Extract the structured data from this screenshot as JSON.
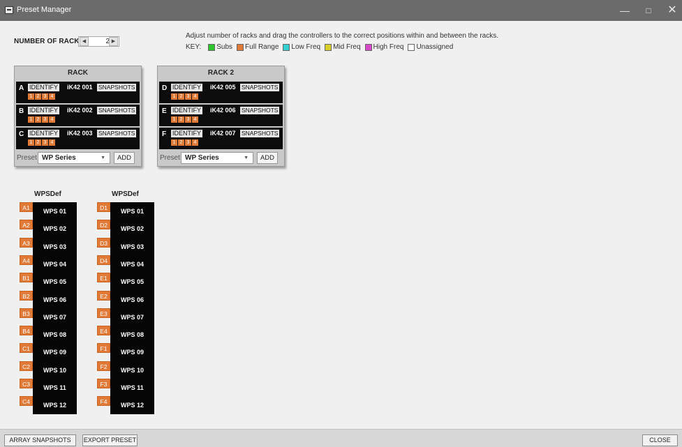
{
  "window": {
    "title": "Preset Manager",
    "minimize_icon": "minimize-icon",
    "maximize_icon": "maximize-icon",
    "close_icon": "close-icon"
  },
  "controls": {
    "num_racks_label": "NUMBER OF RACKS",
    "num_racks_value": "2",
    "instructions": "Adjust number of racks and drag the controllers to the correct positions within and between the racks.",
    "key_label": "KEY:"
  },
  "key": [
    {
      "label": "Subs",
      "color": "#2ec52e"
    },
    {
      "label": "Full Range",
      "color": "#e27a37"
    },
    {
      "label": "Low Freq",
      "color": "#35d0d0"
    },
    {
      "label": "Mid Freq",
      "color": "#d7d02a"
    },
    {
      "label": "High Freq",
      "color": "#d548c8"
    },
    {
      "label": "Unassigned",
      "color": "#ffffff"
    }
  ],
  "racks": [
    {
      "title": "RACK",
      "slots": [
        {
          "letter": "A",
          "identify": "IDENTIFY",
          "name": "iK42 001",
          "snapshots": "SNAPSHOTS",
          "channels": [
            "1",
            "2",
            "3",
            "4"
          ]
        },
        {
          "letter": "B",
          "identify": "IDENTIFY",
          "name": "iK42 002",
          "snapshots": "SNAPSHOTS",
          "channels": [
            "1",
            "2",
            "3",
            "4"
          ]
        },
        {
          "letter": "C",
          "identify": "IDENTIFY",
          "name": "iK42 003",
          "snapshots": "SNAPSHOTS",
          "channels": [
            "1",
            "2",
            "3",
            "4"
          ]
        }
      ],
      "preset_label": "Preset",
      "preset_value": "WP Series",
      "add_label": "ADD"
    },
    {
      "title": "RACK 2",
      "slots": [
        {
          "letter": "D",
          "identify": "IDENTIFY",
          "name": "iK42 005",
          "snapshots": "SNAPSHOTS",
          "channels": [
            "1",
            "2",
            "3",
            "4"
          ]
        },
        {
          "letter": "E",
          "identify": "IDENTIFY",
          "name": "iK42 006",
          "snapshots": "SNAPSHOTS",
          "channels": [
            "1",
            "2",
            "3",
            "4"
          ]
        },
        {
          "letter": "F",
          "identify": "IDENTIFY",
          "name": "iK42 007",
          "snapshots": "SNAPSHOTS",
          "channels": [
            "1",
            "2",
            "3",
            "4"
          ]
        }
      ],
      "preset_label": "Preset",
      "preset_value": "WP Series",
      "add_label": "ADD"
    }
  ],
  "preset_columns": [
    {
      "title": "WPSDef",
      "rows": [
        {
          "tag": "A1",
          "name": "WPS 01"
        },
        {
          "tag": "A2",
          "name": "WPS 02"
        },
        {
          "tag": "A3",
          "name": "WPS 03"
        },
        {
          "tag": "A4",
          "name": "WPS 04"
        },
        {
          "tag": "B1",
          "name": "WPS 05"
        },
        {
          "tag": "B2",
          "name": "WPS 06"
        },
        {
          "tag": "B3",
          "name": "WPS 07"
        },
        {
          "tag": "B4",
          "name": "WPS 08"
        },
        {
          "tag": "C1",
          "name": "WPS 09"
        },
        {
          "tag": "C2",
          "name": "WPS 10"
        },
        {
          "tag": "C3",
          "name": "WPS 11"
        },
        {
          "tag": "C4",
          "name": "WPS 12"
        }
      ]
    },
    {
      "title": "WPSDef",
      "rows": [
        {
          "tag": "D1",
          "name": "WPS 01"
        },
        {
          "tag": "D2",
          "name": "WPS 02"
        },
        {
          "tag": "D3",
          "name": "WPS 03"
        },
        {
          "tag": "D4",
          "name": "WPS 04"
        },
        {
          "tag": "E1",
          "name": "WPS 05"
        },
        {
          "tag": "E2",
          "name": "WPS 06"
        },
        {
          "tag": "E3",
          "name": "WPS 07"
        },
        {
          "tag": "E4",
          "name": "WPS 08"
        },
        {
          "tag": "F1",
          "name": "WPS 09"
        },
        {
          "tag": "F2",
          "name": "WPS 10"
        },
        {
          "tag": "F3",
          "name": "WPS 11"
        },
        {
          "tag": "F4",
          "name": "WPS 12"
        }
      ]
    }
  ],
  "bottom": {
    "array_snapshots": "ARRAY SNAPSHOTS",
    "export_preset": "EXPORT PRESET",
    "close": "CLOSE"
  }
}
